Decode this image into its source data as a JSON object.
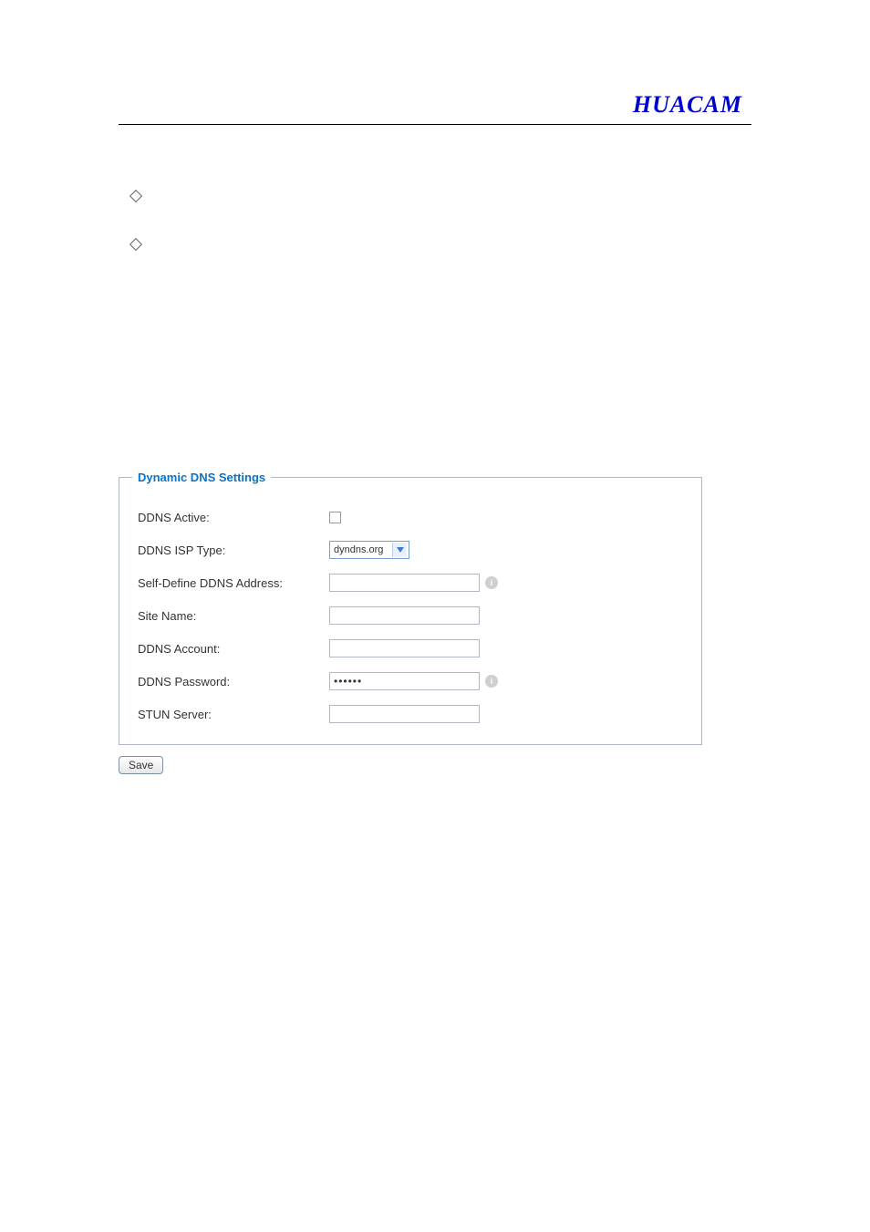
{
  "brand": "HUACAM",
  "fieldset_title": "Dynamic DNS Settings",
  "rows": {
    "ddns_active_label": "DDNS Active:",
    "ddns_isp_label": "DDNS ISP Type:",
    "ddns_isp_value": "dyndns.org",
    "self_define_label": "Self-Define DDNS Address:",
    "self_define_value": "",
    "site_name_label": "Site Name:",
    "site_name_value": "",
    "ddns_account_label": "DDNS Account:",
    "ddns_account_value": "",
    "ddns_password_label": "DDNS Password:",
    "ddns_password_value": "••••••",
    "stun_server_label": "STUN Server:",
    "stun_server_value": ""
  },
  "save_label": "Save",
  "info_glyph": "i"
}
